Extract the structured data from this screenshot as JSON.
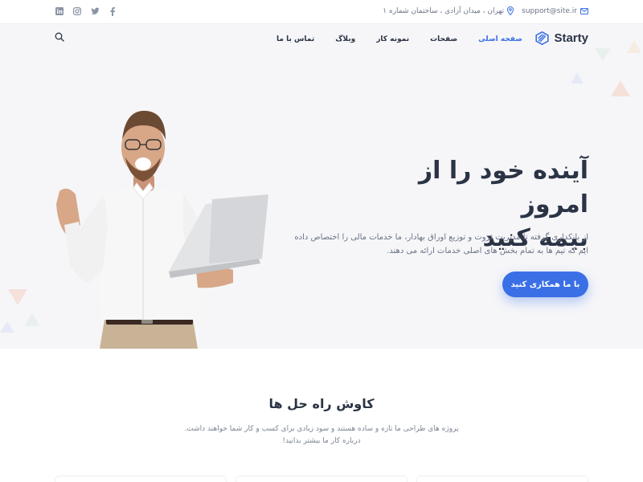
{
  "topbar": {
    "email": "support@site.ir",
    "address": "تهران ، میدان آزادی ، ساختمان شماره ۱",
    "social": [
      "facebook-icon",
      "instagram-icon",
      "twitter-icon",
      "linkedin-icon"
    ]
  },
  "nav": {
    "logo_text": "Starty",
    "items": [
      {
        "label": "صفحه اصلی",
        "active": true
      },
      {
        "label": "صفحات",
        "active": false
      },
      {
        "label": "نمونه کار",
        "active": false
      },
      {
        "label": "وبلاگ",
        "active": false
      },
      {
        "label": "تماس با ما",
        "active": false
      }
    ]
  },
  "hero": {
    "title_line1": "آینده خود را از امروز",
    "title_line2": "بیمه کنید",
    "description": "از بانکداری گرفته تا مدیریت ثروت و توزیع اوراق بهادار، ما خدمات مالی را اختصاص داده ایم که تیم ها به تمام بخش های اصلی خدمات ارائه می دهند.",
    "cta": "با ما همکاری کنید"
  },
  "section": {
    "title": "کاوش راه حل ها",
    "description": "پروژه های طراحی ما تازه و ساده هستند و سود زیادی برای کسب و کار شما خواهند داشت. درباره کار ما بیشتر بدانید!"
  },
  "colors": {
    "accent": "#3a6fe6",
    "text": "#2b3445",
    "muted": "#6b7384",
    "hero_bg": "#f6f6f9"
  }
}
